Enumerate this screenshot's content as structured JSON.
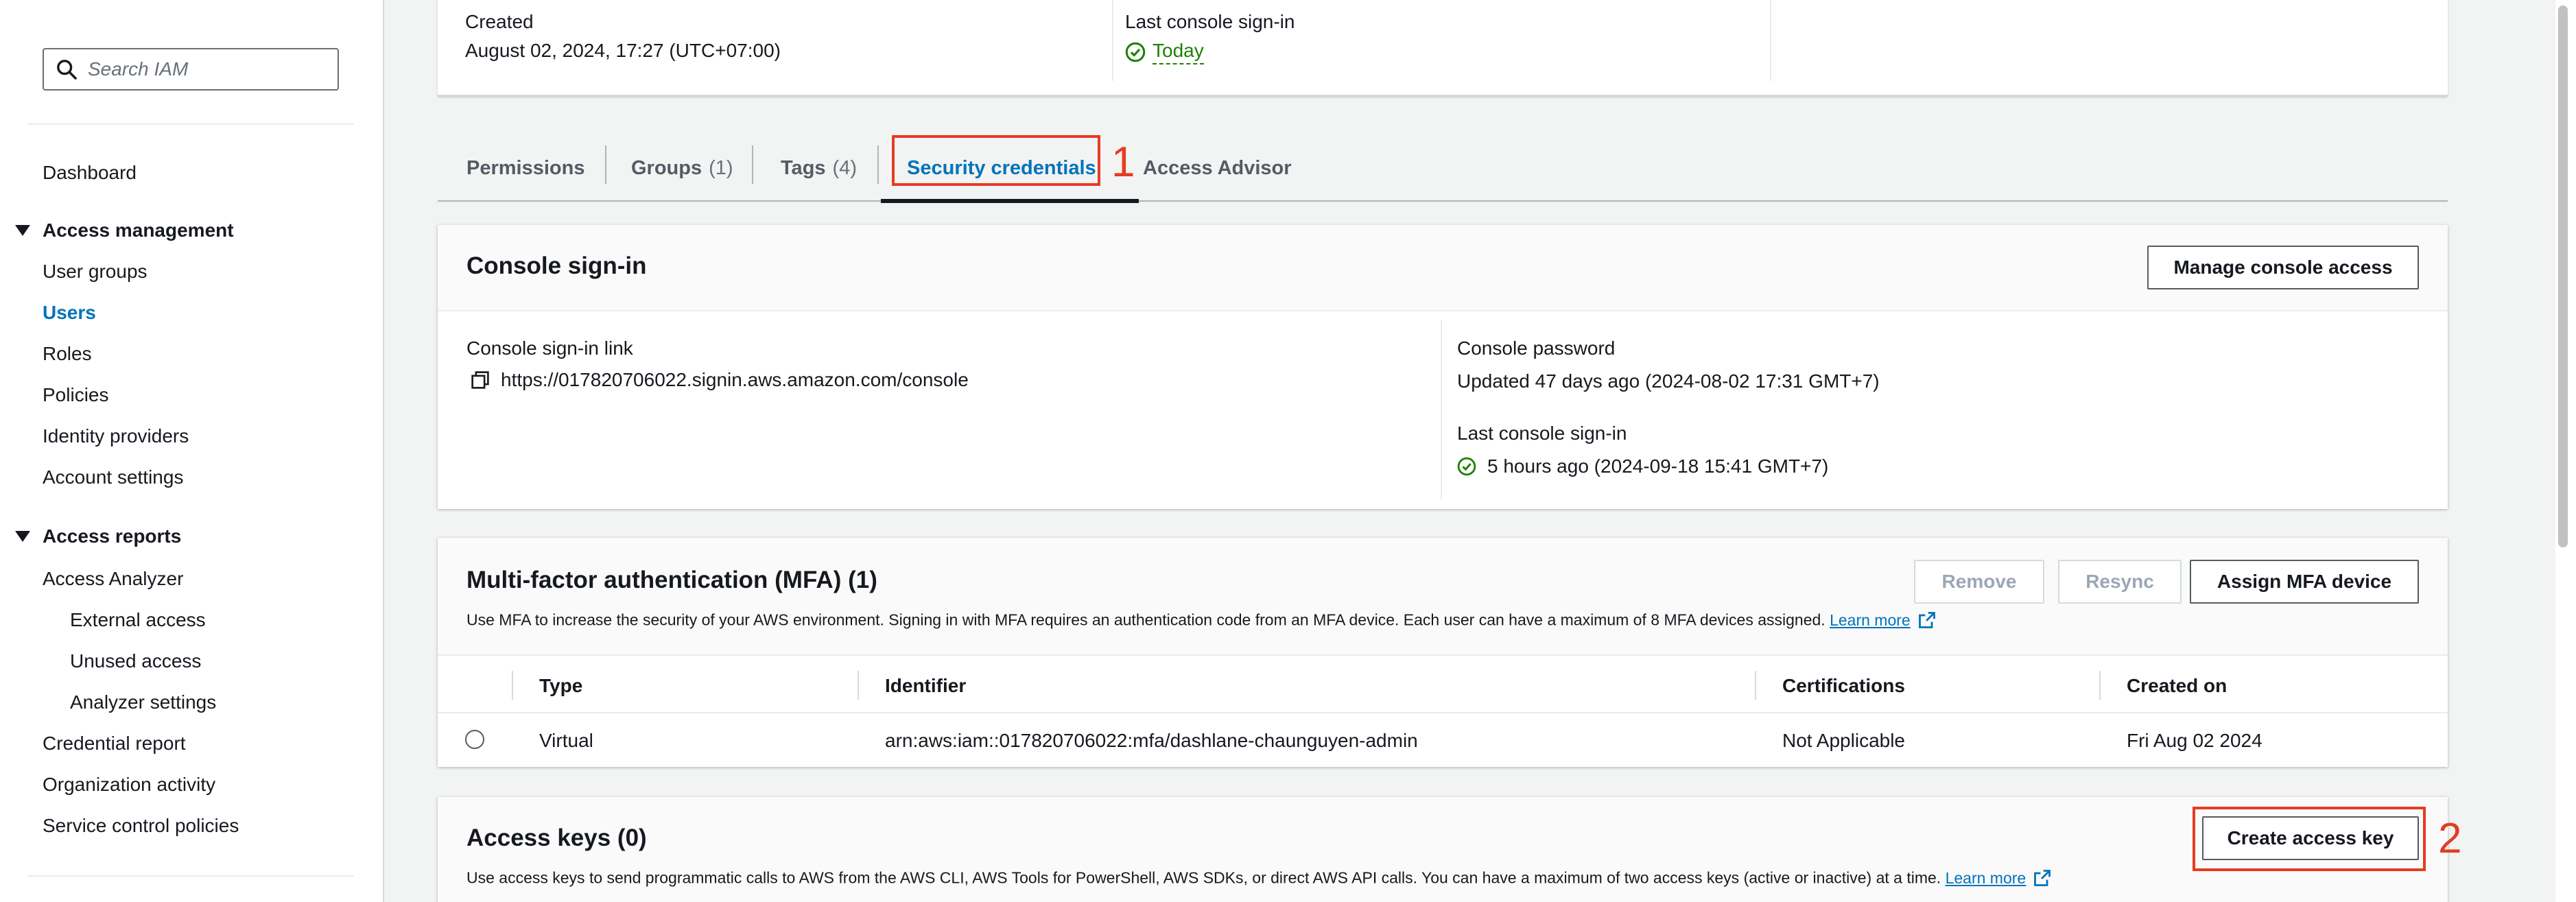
{
  "sidebar": {
    "search_placeholder": "Search IAM",
    "dashboard": "Dashboard",
    "access_management": {
      "label": "Access management",
      "items": [
        "User groups",
        "Users",
        "Roles",
        "Policies",
        "Identity providers",
        "Account settings"
      ],
      "active": "Users"
    },
    "access_reports": {
      "label": "Access reports",
      "analyzer": "Access Analyzer",
      "analyzer_items": [
        "External access",
        "Unused access",
        "Analyzer settings"
      ],
      "items": [
        "Credential report",
        "Organization activity",
        "Service control policies"
      ]
    }
  },
  "summary": {
    "created_label": "Created",
    "created_value": "August 02, 2024, 17:27 (UTC+07:00)",
    "last_signin_label": "Last console sign-in",
    "last_signin_value": "Today"
  },
  "tabs": [
    {
      "label": "Permissions",
      "count": ""
    },
    {
      "label": "Groups",
      "count": "(1)"
    },
    {
      "label": "Tags",
      "count": "(4)"
    },
    {
      "label": "Security credentials",
      "count": ""
    },
    {
      "label": "Access Advisor",
      "count": ""
    }
  ],
  "annotations": {
    "first": "1",
    "second": "2"
  },
  "console_signin": {
    "title": "Console sign-in",
    "manage_button": "Manage console access",
    "link_label": "Console sign-in link",
    "link_value": "https://017820706022.signin.aws.amazon.com/console",
    "password_label": "Console password",
    "password_value": "Updated 47 days ago (2024-08-02 17:31 GMT+7)",
    "last_signin_label": "Last console sign-in",
    "last_signin_value": "5 hours ago (2024-09-18 15:41 GMT+7)"
  },
  "mfa": {
    "title": "Multi-factor authentication (MFA) (1)",
    "description": "Use MFA to increase the security of your AWS environment. Signing in with MFA requires an authentication code from an MFA device. Each user can have a maximum of 8 MFA devices assigned.",
    "learn_more": "Learn more",
    "buttons": {
      "remove": "Remove",
      "resync": "Resync",
      "assign": "Assign MFA device"
    },
    "columns": [
      "Type",
      "Identifier",
      "Certifications",
      "Created on"
    ],
    "rows": [
      {
        "type": "Virtual",
        "identifier": "arn:aws:iam::017820706022:mfa/dashlane-chaunguyen-admin",
        "certifications": "Not Applicable",
        "created_on": "Fri Aug 02 2024"
      }
    ]
  },
  "access_keys": {
    "title": "Access keys (0)",
    "description": "Use access keys to send programmatic calls to AWS from the AWS CLI, AWS Tools for PowerShell, AWS SDKs, or direct AWS API calls. You can have a maximum of two access keys (active or inactive) at a time.",
    "learn_more": "Learn more",
    "create_button": "Create access key"
  },
  "colors": {
    "accent": "#0073bb",
    "success": "#1d8102",
    "annotation": "#e53c22"
  }
}
